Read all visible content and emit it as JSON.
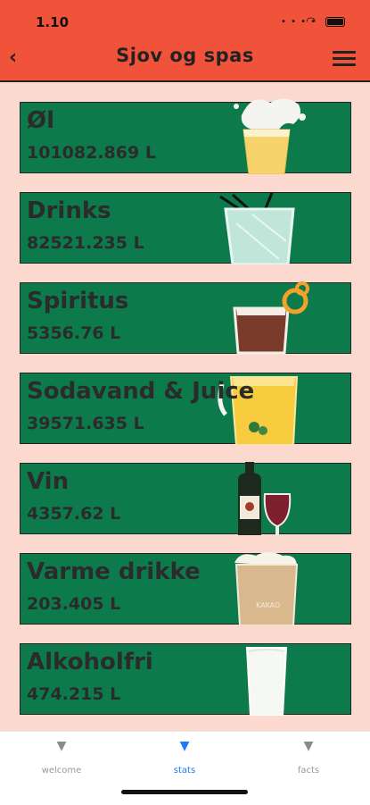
{
  "status": {
    "time": "1.10"
  },
  "nav": {
    "title": "Sjov og spas"
  },
  "categories": [
    {
      "name": "Øl",
      "value": "101082.869 L",
      "icon": "beer-glass-icon"
    },
    {
      "name": "Drinks",
      "value": "82521.235 L",
      "icon": "cocktail-glass-icon"
    },
    {
      "name": "Spiritus",
      "value": "5356.76 L",
      "icon": "spirits-glass-icon"
    },
    {
      "name": "Sodavand & Juice",
      "value": "39571.635 L",
      "icon": "juice-jug-icon"
    },
    {
      "name": "Vin",
      "value": "4357.62 L",
      "icon": "wine-bottle-icon"
    },
    {
      "name": "Varme drikke",
      "value": "203.405 L",
      "icon": "hot-drink-cup-icon"
    },
    {
      "name": "Alkoholfri",
      "value": "474.215 L",
      "icon": "water-glass-icon"
    }
  ],
  "tabs": [
    {
      "label": "welcome",
      "active": false
    },
    {
      "label": "stats",
      "active": true
    },
    {
      "label": "facts",
      "active": false
    }
  ],
  "colors": {
    "header": "#f0533a",
    "background": "#fcd9cf",
    "card": "#0d7a4b",
    "active_tab": "#1e7cf2"
  }
}
